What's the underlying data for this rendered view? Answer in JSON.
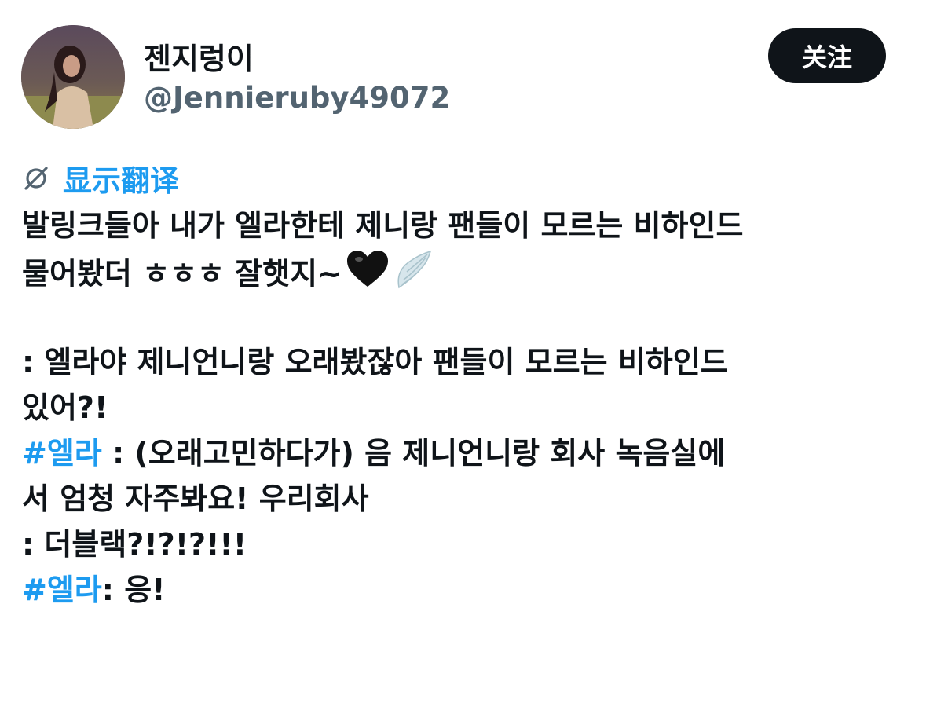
{
  "user": {
    "display_name": "젠지렁이",
    "handle": "@Jennieruby49072"
  },
  "follow_button": {
    "label": "关注"
  },
  "translate": {
    "label": "显示翻译",
    "icon": "translate-globe-icon"
  },
  "tweet": {
    "line1": "발링크들아 내가 엘라한테 제니랑 팬들이 모르는 비하인드",
    "line2": "물어봤더 ㅎㅎㅎ 잘햇지~",
    "heart_emoji": "black-heart-icon",
    "wing_emoji": "wing-icon",
    "line3": ": 엘라야 제니언니랑 오래봤잖아 팬들이 모르는 비하인드",
    "line4": "있어?!",
    "hashtag1": "#엘라",
    "line5_rest": " : (오래고민하다가) 음 제니언니랑 회사 녹음실에",
    "line6": "서 엄청 자주봐요! 우리회사",
    "line7": ": 더블랙?!?!?!!!",
    "hashtag2": "#엘라",
    "line8_rest": ": 응!"
  },
  "colors": {
    "accent": "#1d9bf0",
    "text": "#0f1419",
    "secondary": "#536471",
    "button_bg": "#0f1419"
  }
}
